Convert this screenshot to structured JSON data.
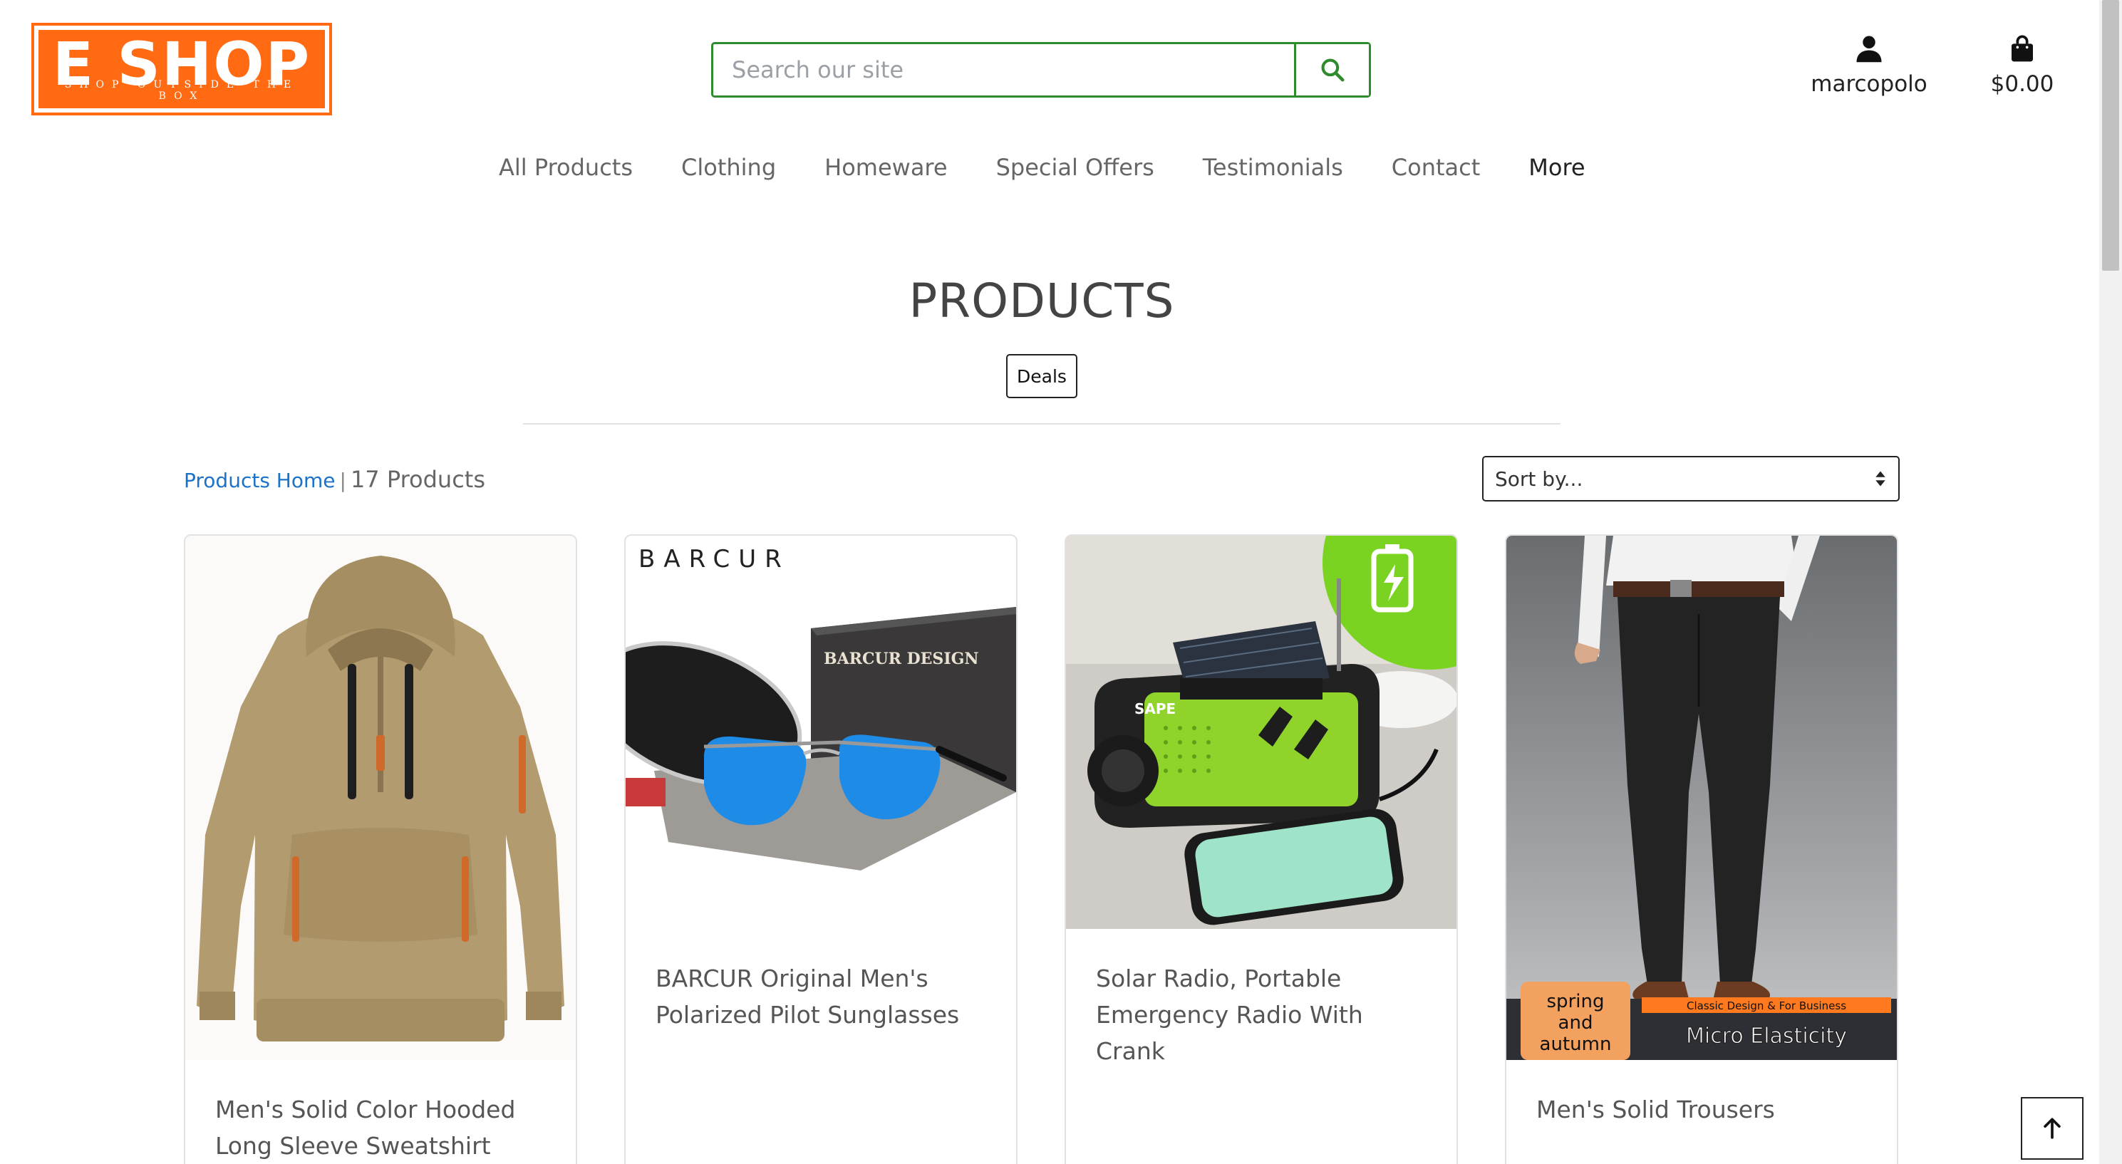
{
  "logo": {
    "title": "E SHOP",
    "tagline": "Shop Outside The Box"
  },
  "search": {
    "placeholder": "Search our site",
    "icon": "search-icon"
  },
  "account": {
    "username": "marcopolo",
    "icon": "user-icon"
  },
  "cart": {
    "total": "$0.00",
    "icon": "shopping-bag-icon"
  },
  "nav": {
    "items": [
      "All Products",
      "Clothing",
      "Homeware",
      "Special Offers",
      "Testimonials",
      "Contact"
    ],
    "more": "More"
  },
  "page": {
    "title": "PRODUCTS",
    "deals_label": "Deals"
  },
  "breadcrumb": {
    "home_link": "Products Home",
    "separator": "|",
    "count": "17 Products"
  },
  "sort": {
    "placeholder": "Sort by..."
  },
  "products": [
    {
      "name": "Men's Solid Color Hooded Long Sleeve Sweatshirt"
    },
    {
      "name": "BARCUR Original Men's Polarized Pilot Sunglasses",
      "image_brand": "BARCUR",
      "box_text": "BARCUR DESIGN"
    },
    {
      "name": "Solar Radio, Portable Emergency Radio With Crank",
      "image_brand": "SAPE"
    },
    {
      "name": "Men's Solid Trousers",
      "badge_left": "spring and autumn",
      "badge_top": "Classic Design & For Business",
      "badge_main": "Micro Elasticity"
    }
  ],
  "colors": {
    "brand_orange": "#ff6a13",
    "search_green": "#2e8b2e",
    "link_blue": "#1a73c9"
  }
}
